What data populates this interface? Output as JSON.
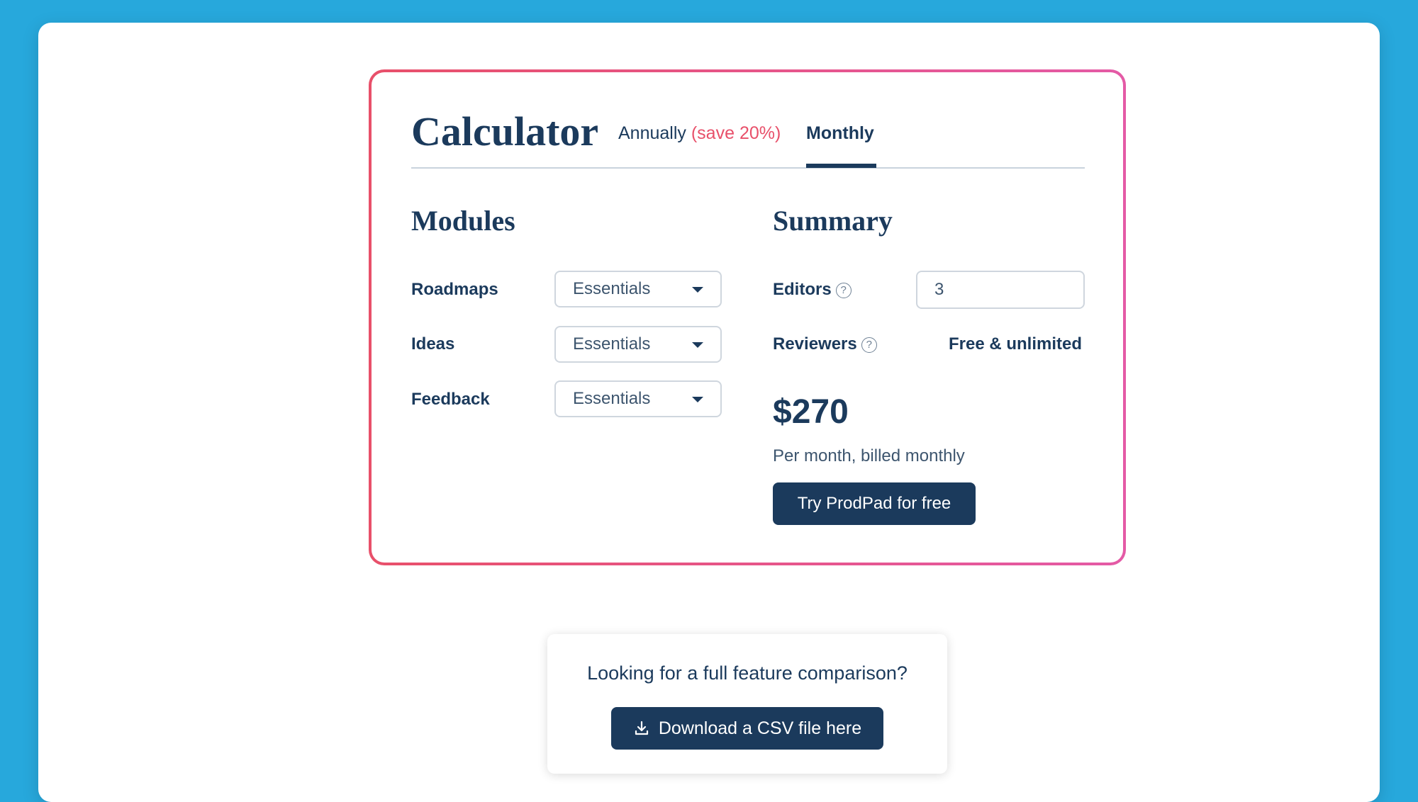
{
  "calculator": {
    "title": "Calculator",
    "tabs": {
      "annually": {
        "label": "Annually",
        "note": "(save 20%)"
      },
      "monthly": {
        "label": "Monthly"
      }
    },
    "active_tab": "Monthly"
  },
  "modules": {
    "title": "Modules",
    "rows": [
      {
        "label": "Roadmaps",
        "value": "Essentials"
      },
      {
        "label": "Ideas",
        "value": "Essentials"
      },
      {
        "label": "Feedback",
        "value": "Essentials"
      }
    ]
  },
  "summary": {
    "title": "Summary",
    "editors": {
      "label": "Editors",
      "value": "3"
    },
    "reviewers": {
      "label": "Reviewers",
      "value": "Free & unlimited"
    },
    "price": "$270",
    "billing": "Per month, billed monthly",
    "cta": "Try ProdPad for free"
  },
  "comparison": {
    "text": "Looking for a full feature comparison?",
    "button": "Download a CSV file here"
  },
  "colors": {
    "background": "#27a8dc",
    "navy": "#1b3a5c",
    "accent": "#e8506a",
    "accent_end": "#e45aa6"
  },
  "icons": {
    "help": "question-circle-icon",
    "dropdown": "caret-down-icon",
    "download": "download-icon"
  }
}
